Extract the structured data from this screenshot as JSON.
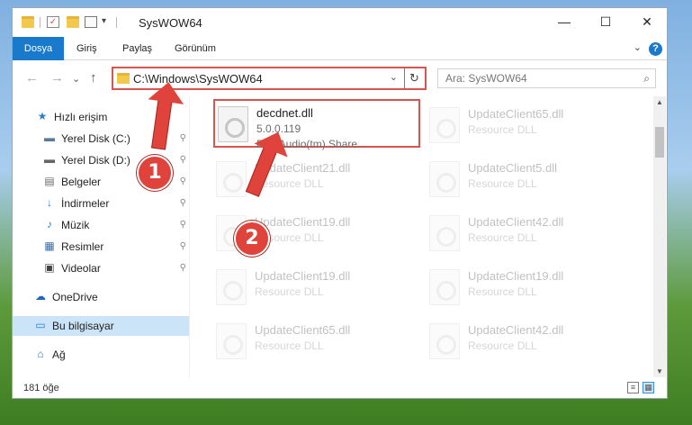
{
  "window": {
    "title": "SysWOW64",
    "minimize": "—",
    "maximize": "☐",
    "close": "✕"
  },
  "ribbon": {
    "tabs": [
      "Dosya",
      "Giriş",
      "Paylaş",
      "Görünüm"
    ],
    "help": "?",
    "collapse": "⌄"
  },
  "nav": {
    "back": "←",
    "forward": "→",
    "recent": "⌄",
    "up": "↑"
  },
  "address": {
    "path": "C:\\Windows\\SysWOW64",
    "refresh": "↻",
    "dropdown": "⌄"
  },
  "search": {
    "placeholder": "Ara: SysWOW64",
    "icon": "⌕"
  },
  "sidebar": {
    "items": [
      {
        "label": "Hızlı erişim",
        "icon": "star-icon",
        "glyph": "★",
        "color": "#2b7cd3"
      },
      {
        "label": "Yerel Disk (C:)",
        "icon": "drive-icon",
        "glyph": "▬",
        "color": "#5a7a9a"
      },
      {
        "label": "Yerel Disk (D:)",
        "icon": "drive-icon",
        "glyph": "▬",
        "color": "#666"
      },
      {
        "label": "Belgeler",
        "icon": "documents-icon",
        "glyph": "▤",
        "color": "#6b6b6b"
      },
      {
        "label": "İndirmeler",
        "icon": "downloads-icon",
        "glyph": "↓",
        "color": "#2b7cd3"
      },
      {
        "label": "Müzik",
        "icon": "music-icon",
        "glyph": "♪",
        "color": "#2b7cd3"
      },
      {
        "label": "Resimler",
        "icon": "pictures-icon",
        "glyph": "▦",
        "color": "#3c6ea8"
      },
      {
        "label": "Videolar",
        "icon": "videos-icon",
        "glyph": "▣",
        "color": "#444"
      },
      {
        "label": "OneDrive",
        "icon": "cloud-icon",
        "glyph": "☁",
        "color": "#1e66c4"
      },
      {
        "label": "Bu bilgisayar",
        "icon": "computer-icon",
        "glyph": "▭",
        "color": "#2b7cd3"
      },
      {
        "label": "Ağ",
        "icon": "network-icon",
        "glyph": "⌂",
        "color": "#2b7cd3"
      }
    ],
    "pin_glyph": "📌"
  },
  "files": [
    {
      "name": "decdnet.dll",
      "version": "5.0.0.119",
      "description": "RealAudio(tm) Share..."
    },
    {
      "name": "UpdateClient65.dll",
      "description": "Resource DLL"
    },
    {
      "name": "UpdateClient21.dll",
      "description": "Resource DLL"
    },
    {
      "name": "UpdateClient5.dll",
      "description": "Resource DLL"
    },
    {
      "name": "UpdateClient19.dll",
      "description": "Resource DLL"
    },
    {
      "name": "UpdateClient42.dll",
      "description": "Resource DLL"
    },
    {
      "name": "UpdateClient19.dll",
      "description": "Resource DLL"
    },
    {
      "name": "UpdateClient19.dll",
      "description": "Resource DLL"
    },
    {
      "name": "UpdateClient65.dll",
      "description": "Resource DLL"
    },
    {
      "name": "UpdateClient42.dll",
      "description": "Resource DLL"
    }
  ],
  "status": {
    "count": "181 öğe"
  },
  "annotations": {
    "step1": "1",
    "step2": "2"
  },
  "colors": {
    "accent": "#1979ca",
    "highlight": "#d9534f",
    "annotation": "#e0433b"
  }
}
